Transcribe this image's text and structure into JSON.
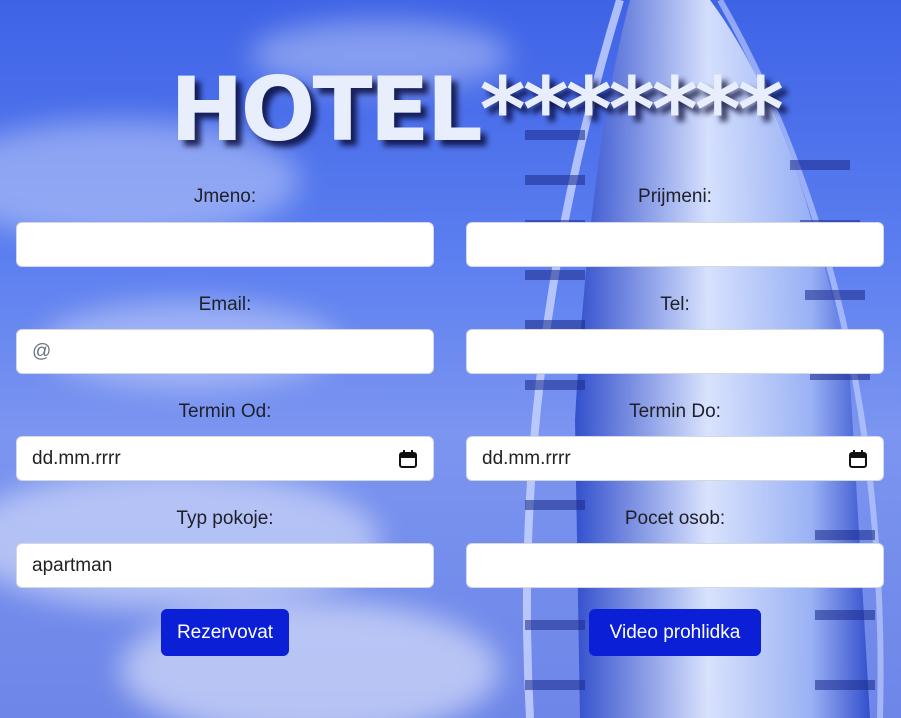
{
  "title": "HOTEL*******",
  "form": {
    "first_name_label": "Jmeno:",
    "last_name_label": "Prijmeni:",
    "email_label": "Email:",
    "email_placeholder": "@",
    "phone_label": "Tel:",
    "date_from_label": "Termin Od:",
    "date_from_value": "dd.mm.rrrr",
    "date_to_label": "Termin Do:",
    "date_to_value": "dd.mm.rrrr",
    "room_type_label": "Typ pokoje:",
    "room_type_value": "apartman",
    "guests_label": "Pocet osob:"
  },
  "buttons": {
    "reserve": "Rezervovat",
    "video_tour": "Video prohlidka"
  },
  "colors": {
    "button_bg": "#0a1fd6",
    "sky": "#4a6ee8"
  },
  "icons": [
    "calendar-icon"
  ]
}
